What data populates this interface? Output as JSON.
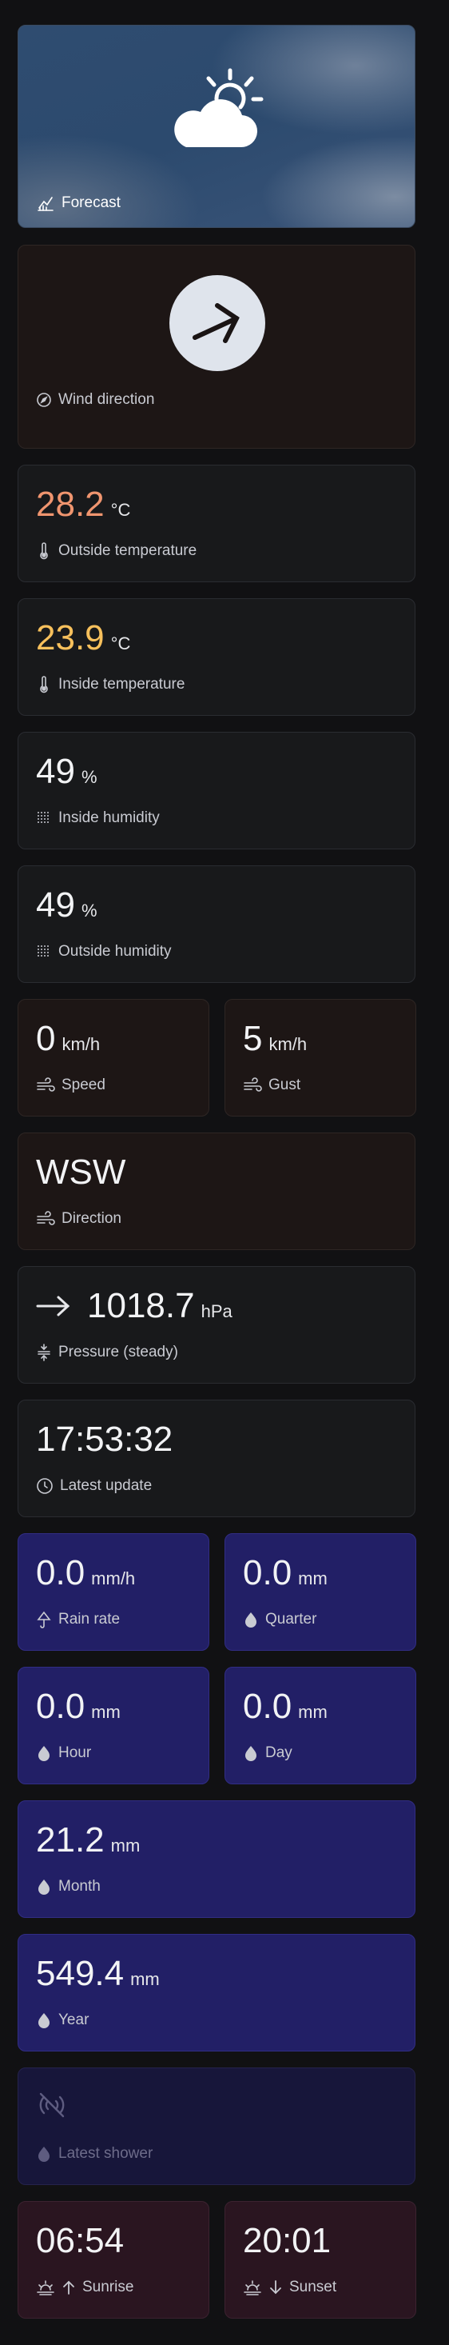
{
  "forecast": {
    "label": "Forecast",
    "icon": "partly-cloudy-icon"
  },
  "wind_direction_card": {
    "label": "Wind direction",
    "icon": "arrow-up-right-icon"
  },
  "outside_temperature": {
    "value": "28.2",
    "unit": "°C",
    "label": "Outside temperature",
    "color": "#f0956f"
  },
  "inside_temperature": {
    "value": "23.9",
    "unit": "°C",
    "label": "Inside temperature",
    "color": "#f7c05c"
  },
  "inside_humidity": {
    "value": "49",
    "unit": "%",
    "label": "Inside humidity"
  },
  "outside_humidity": {
    "value": "49",
    "unit": "%",
    "label": "Outside humidity"
  },
  "wind_speed": {
    "value": "0",
    "unit": "km/h",
    "label": "Speed"
  },
  "wind_gust": {
    "value": "5",
    "unit": "km/h",
    "label": "Gust"
  },
  "wind_dir": {
    "value": "WSW",
    "label": "Direction"
  },
  "pressure": {
    "value": "1018.7",
    "unit": "hPa",
    "label": "Pressure (steady)",
    "trend_icon": "arrow-right-icon"
  },
  "latest_update": {
    "value": "17:53:32",
    "label": "Latest update"
  },
  "rain_rate": {
    "value": "0.0",
    "unit": "mm/h",
    "label": "Rain rate"
  },
  "rain_quarter": {
    "value": "0.0",
    "unit": "mm",
    "label": "Quarter"
  },
  "rain_hour": {
    "value": "0.0",
    "unit": "mm",
    "label": "Hour"
  },
  "rain_day": {
    "value": "0.0",
    "unit": "mm",
    "label": "Day"
  },
  "rain_month": {
    "value": "21.2",
    "unit": "mm",
    "label": "Month"
  },
  "rain_year": {
    "value": "549.4",
    "unit": "mm",
    "label": "Year"
  },
  "latest_shower": {
    "label": "Latest shower",
    "icon": "signal-off-icon"
  },
  "sunrise": {
    "value": "06:54",
    "label": "Sunrise"
  },
  "sunset": {
    "value": "20:01",
    "label": "Sunset"
  },
  "colors": {
    "background": "#111113",
    "card": "#18191b",
    "wind_card": "#1d1615",
    "rain_card": "#221f66",
    "sun_card": "#2a1520"
  }
}
